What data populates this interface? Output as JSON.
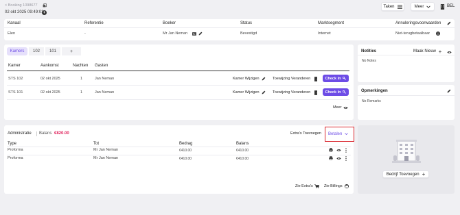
{
  "header": {
    "back_label": "< Booking 1098677",
    "datetime": "02 okt 2025 09:49:01",
    "tasks_label": "Taken",
    "more_label": "Meer",
    "lang_label": "BEL"
  },
  "summary": {
    "headers": [
      "Kanaal",
      "Referentie",
      "Boeker",
      "Status",
      "Marktsegment",
      "Annuleringsvoorwaarden"
    ],
    "values": {
      "kanaal": "Elen",
      "referentie": "-",
      "boeker": "Mr Jan Neman",
      "status": "Bevestigd",
      "marktsegment": "Internet",
      "annulering": "Niet-terugbetaalbaar"
    }
  },
  "rooms": {
    "tabs": [
      "Kamers",
      "102",
      "101",
      "+"
    ],
    "headers": [
      "Kamer",
      "Aankomst",
      "Nachten",
      "Gasten"
    ],
    "rows": [
      {
        "kamer": "STS 102",
        "aankomst": "02 okt 2025",
        "nachten": "1",
        "gasten": "Jan Neman"
      },
      {
        "kamer": "STS 101",
        "aankomst": "02 okt 2025",
        "nachten": "1",
        "gasten": "Jan Neman"
      }
    ],
    "change_room_label": "Kamer Wijzigen",
    "change_assign_label": "Toewijzing Veranderen",
    "checkin_label": "Check In",
    "more_label": "Meer"
  },
  "notes": {
    "title": "Notities",
    "new_label": "Maak Nieuw",
    "empty": "No Notes"
  },
  "remarks": {
    "title": "Opmerkingen",
    "empty": "No Remarks"
  },
  "admin": {
    "title": "Administratie",
    "balance_label": "Balans",
    "balance_value": "€820.00",
    "extras_label": "Extra's Toevoegen",
    "pay_label": "Betalen",
    "headers": [
      "Type",
      "Tot",
      "Bedrag",
      "Balans"
    ],
    "rows": [
      {
        "type": "Proforma",
        "tot": "Mr Jan Neman",
        "bedrag": "€410.00",
        "balans": "€410.00"
      },
      {
        "type": "Proforma",
        "tot": "Mr Jan Neman",
        "bedrag": "€410.00",
        "balans": "€410.00"
      }
    ],
    "see_extras_label": "Zie Extra's",
    "see_billings_label": "Zie Billings"
  },
  "company": {
    "add_label": "Bedrijf Toevoegen"
  },
  "colors": {
    "accent": "#6d4ce6",
    "balance": "#e0245e",
    "highlight_border": "#d9232b"
  }
}
